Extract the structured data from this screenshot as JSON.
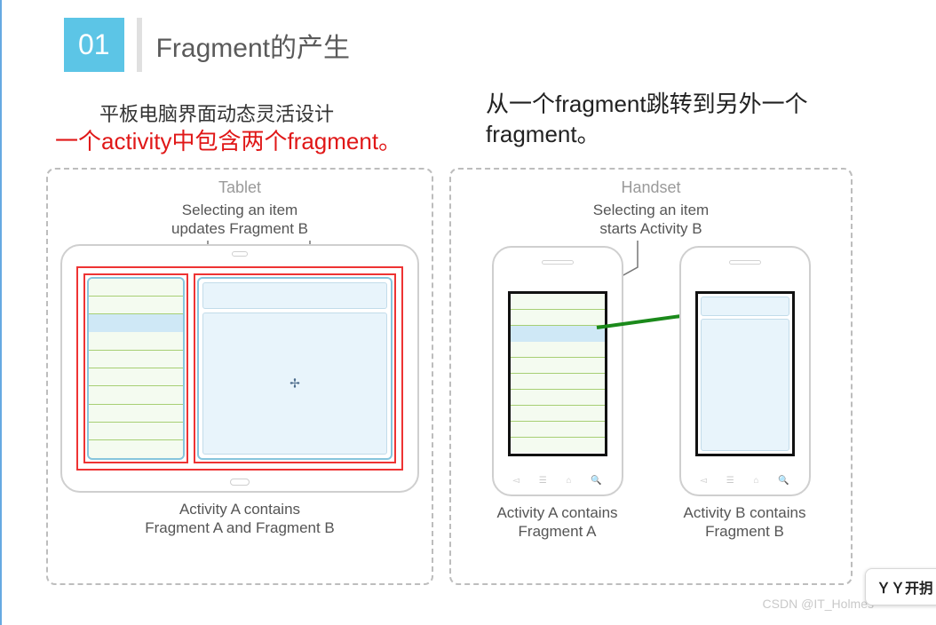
{
  "header": {
    "num": "01",
    "title": "Fragment的产生"
  },
  "subtitle_tablet": "平板电脑界面动态灵活设计",
  "annotation_red": "一个activity中包含两个fragment。",
  "subtitle_handset": "从一个fragment跳转到另外一个fragment。",
  "tablet": {
    "label": "Tablet",
    "note_line1": "Selecting an item",
    "note_line2": "updates Fragment B",
    "caption_line1": "Activity A contains",
    "caption_line2": "Fragment A and Fragment B"
  },
  "handset": {
    "label": "Handset",
    "note_line1": "Selecting an item",
    "note_line2": "starts Activity B",
    "caption_a_line1": "Activity A contains",
    "caption_a_line2": "Fragment A",
    "caption_b_line1": "Activity B contains",
    "caption_b_line2": "Fragment B"
  },
  "cursor": "✢",
  "yy_button": "ＹＹ开抈",
  "watermark": "CSDN @IT_Holmes"
}
